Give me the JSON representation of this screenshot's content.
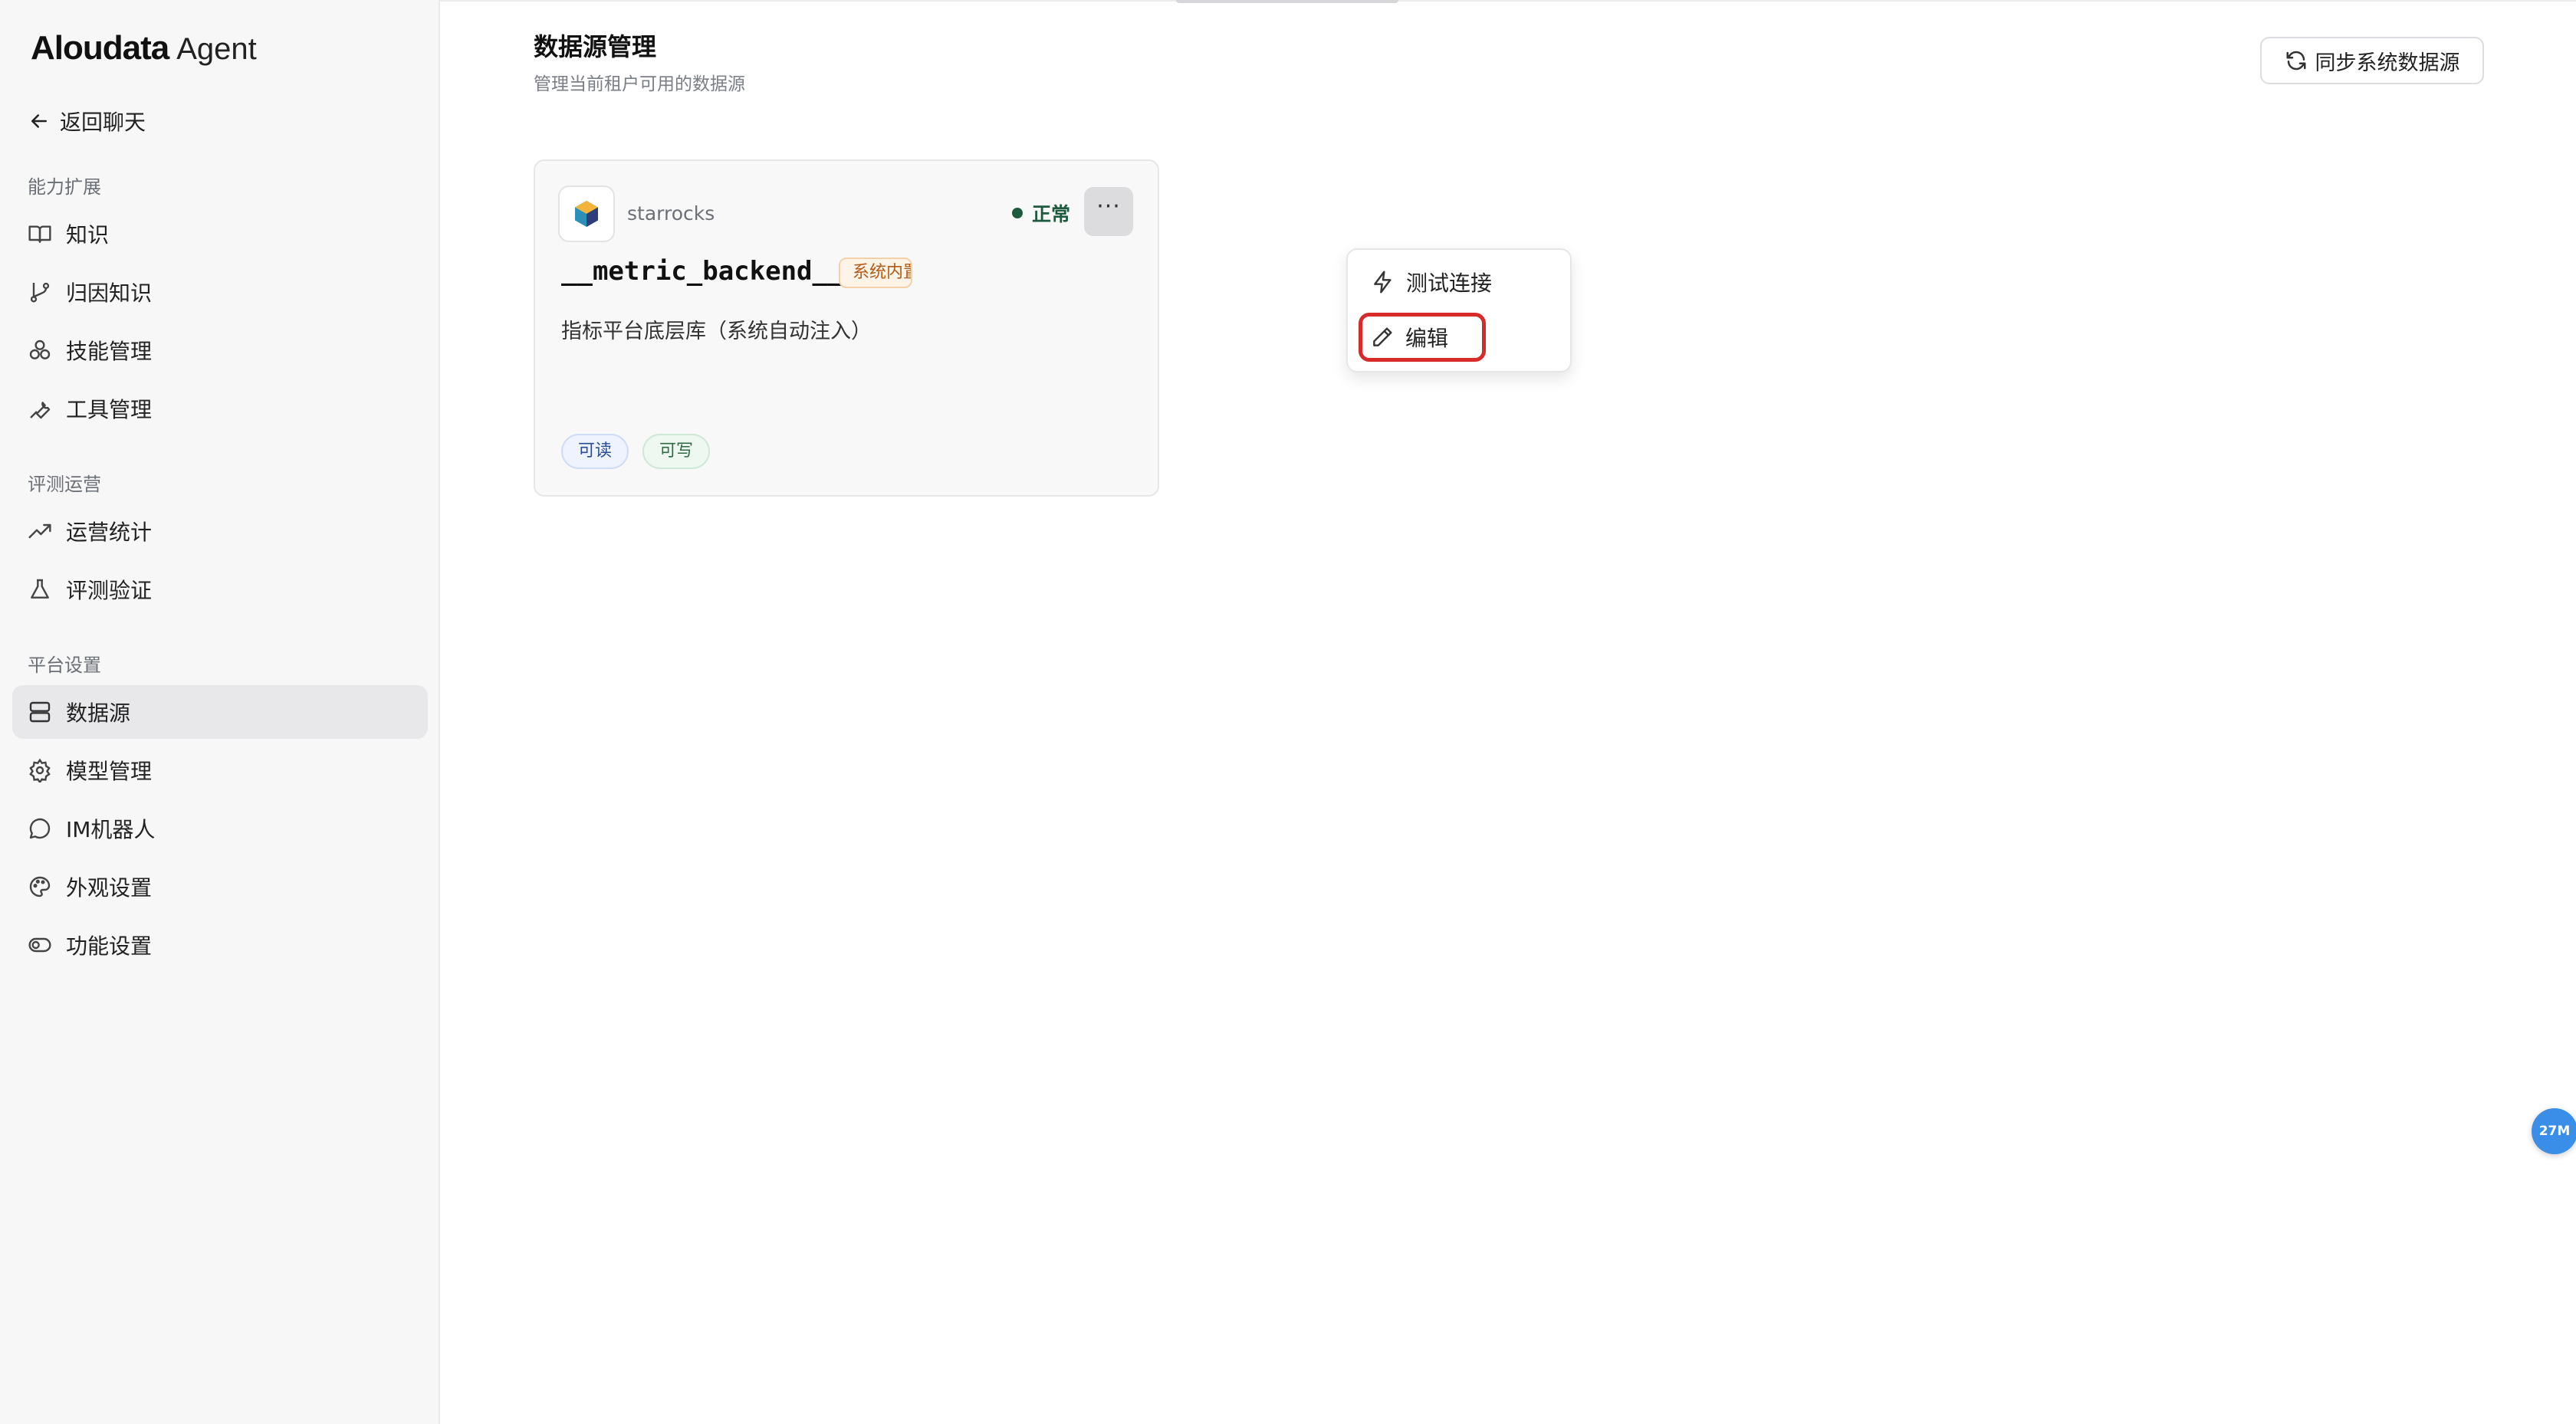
{
  "app": {
    "logo_main": "Aloudata",
    "logo_sub": "Agent"
  },
  "sidebar": {
    "back_label": "返回聊天",
    "sections": [
      {
        "title": "能力扩展",
        "items": [
          {
            "label": "知识",
            "icon": "book-icon"
          },
          {
            "label": "归因知识",
            "icon": "git-branch-icon"
          },
          {
            "label": "技能管理",
            "icon": "skills-icon"
          },
          {
            "label": "工具管理",
            "icon": "wrench-icon"
          }
        ]
      },
      {
        "title": "评测运营",
        "items": [
          {
            "label": "运营统计",
            "icon": "trending-up-icon"
          },
          {
            "label": "评测验证",
            "icon": "flask-icon"
          }
        ]
      },
      {
        "title": "平台设置",
        "items": [
          {
            "label": "数据源",
            "icon": "server-icon",
            "active": true
          },
          {
            "label": "模型管理",
            "icon": "gear-icon"
          },
          {
            "label": "IM机器人",
            "icon": "chat-bubble-icon"
          },
          {
            "label": "外观设置",
            "icon": "palette-icon"
          },
          {
            "label": "功能设置",
            "icon": "toggle-icon"
          }
        ]
      }
    ]
  },
  "main": {
    "title": "数据源管理",
    "subtitle": "管理当前租户可用的数据源",
    "sync_button": "同步系统数据源"
  },
  "card": {
    "db_type": "starrocks",
    "status": "正常",
    "status_color": "#1e5a3e",
    "name": "__metric_backend__",
    "badge": "系统内置",
    "description": "指标平台底层库（系统自动注入）",
    "tags": [
      "可读",
      "可写"
    ]
  },
  "dropdown": {
    "items": [
      {
        "label": "测试连接",
        "icon": "zap-icon"
      },
      {
        "label": "编辑",
        "icon": "pencil-icon",
        "highlighted": true
      }
    ]
  },
  "floating_badge": "27M",
  "colors": {
    "highlight_border": "#d92a2a",
    "active_nav_bg": "#e8e8ea"
  }
}
